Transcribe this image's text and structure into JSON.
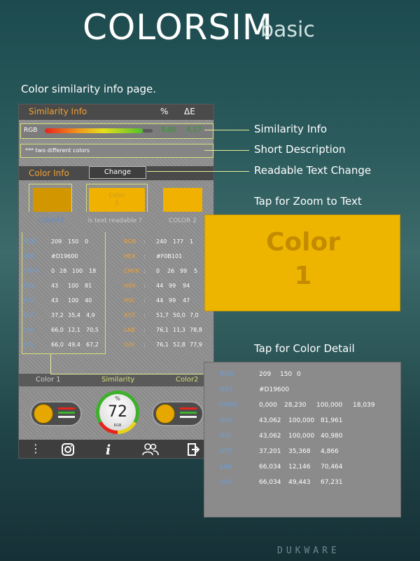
{
  "header": {
    "title": "COLORSIM",
    "title_suffix": "basic",
    "subtitle": "Color similarity info page.",
    "brand": "DUKWARE"
  },
  "callouts": {
    "similarity_info": "Similarity Info",
    "short_description": "Short Description",
    "readable_text_change": "Readable Text Change",
    "tap_zoom": "Tap for Zoom to Text",
    "tap_detail": "Tap for Color Detail"
  },
  "phone": {
    "similarity_header": "Similarity  Info",
    "col_percent": "%",
    "col_delta": "ΔE",
    "rgb_label": "RGB",
    "rgb_percent": "5,00",
    "rgb_delta": "4,17",
    "description": "***  two different colors",
    "color_info_header": "Color Info",
    "change_button": "Change",
    "swatch_center_text": "Color",
    "swatch_center_num": "1",
    "color1_label": "COLOR1",
    "readable_question": "is text readable ?",
    "color2_label": "COLOR 2",
    "color1_hex": "#D19600",
    "color2_hex": "#F0B101",
    "left_rows": [
      {
        "label": "RGB",
        "values": [
          "209",
          "150",
          "0"
        ]
      },
      {
        "label": "HEX",
        "values": [
          "#D19600"
        ]
      },
      {
        "label": "CMYK",
        "values": [
          "0",
          "28",
          "100",
          "18"
        ]
      },
      {
        "label": "HSV",
        "values": [
          "43",
          "100",
          "81"
        ]
      },
      {
        "label": "HSL",
        "values": [
          "43",
          "100",
          "40"
        ]
      },
      {
        "label": "XYZ",
        "values": [
          "37,2",
          "35,4",
          "4,9"
        ]
      },
      {
        "label": "LAB",
        "values": [
          "66,0",
          "12,1",
          "70,5"
        ]
      },
      {
        "label": "LUV",
        "values": [
          "66,0",
          "49,4",
          "67,2"
        ]
      }
    ],
    "right_rows": [
      {
        "label": "RGB",
        "values": [
          "240",
          "177",
          "1"
        ]
      },
      {
        "label": "HEX",
        "values": [
          "#F0B101"
        ]
      },
      {
        "label": "CMYK",
        "values": [
          "0",
          "26",
          "99",
          "5"
        ]
      },
      {
        "label": "HSV",
        "values": [
          "44",
          "99",
          "94"
        ]
      },
      {
        "label": "HSL",
        "values": [
          "44",
          "99",
          "47"
        ]
      },
      {
        "label": "XYZ",
        "values": [
          "51,7",
          "50,0",
          "7,0"
        ]
      },
      {
        "label": "LAB",
        "values": [
          "76,1",
          "11,3",
          "78,8"
        ]
      },
      {
        "label": "LUV",
        "values": [
          "76,1",
          "52,8",
          "77,9"
        ]
      }
    ],
    "sim_bar": {
      "left": "Color 1",
      "center": "Similarity",
      "right": "Color2"
    },
    "gauge": {
      "percent_symbol": "%",
      "value": "72",
      "mode": "RGB"
    },
    "nav": [
      "menu-icon",
      "camera-icon",
      "info-icon",
      "people-icon",
      "exit-icon"
    ]
  },
  "zoom": {
    "line1": "Color",
    "line2": "1",
    "color": "#EEB500"
  },
  "detail": [
    {
      "label": "RGB",
      "values": [
        "209",
        "150",
        "0"
      ]
    },
    {
      "label": "HEX",
      "values": [
        "#D19600"
      ]
    },
    {
      "label": "CMYK",
      "values": [
        "0,000",
        "28,230",
        "100,000",
        "18,039"
      ]
    },
    {
      "label": "HSV",
      "values": [
        "43,062",
        "100,000",
        "81,961"
      ]
    },
    {
      "label": "HSL",
      "values": [
        "43,062",
        "100,000",
        "40,980"
      ]
    },
    {
      "label": "XYZ",
      "values": [
        "37,201",
        "35,368",
        "4,866"
      ]
    },
    {
      "label": "LAB",
      "values": [
        "66,034",
        "12,146",
        "70,464"
      ]
    },
    {
      "label": "LUV",
      "values": [
        "66,034",
        "49,443",
        "67,231"
      ]
    }
  ]
}
